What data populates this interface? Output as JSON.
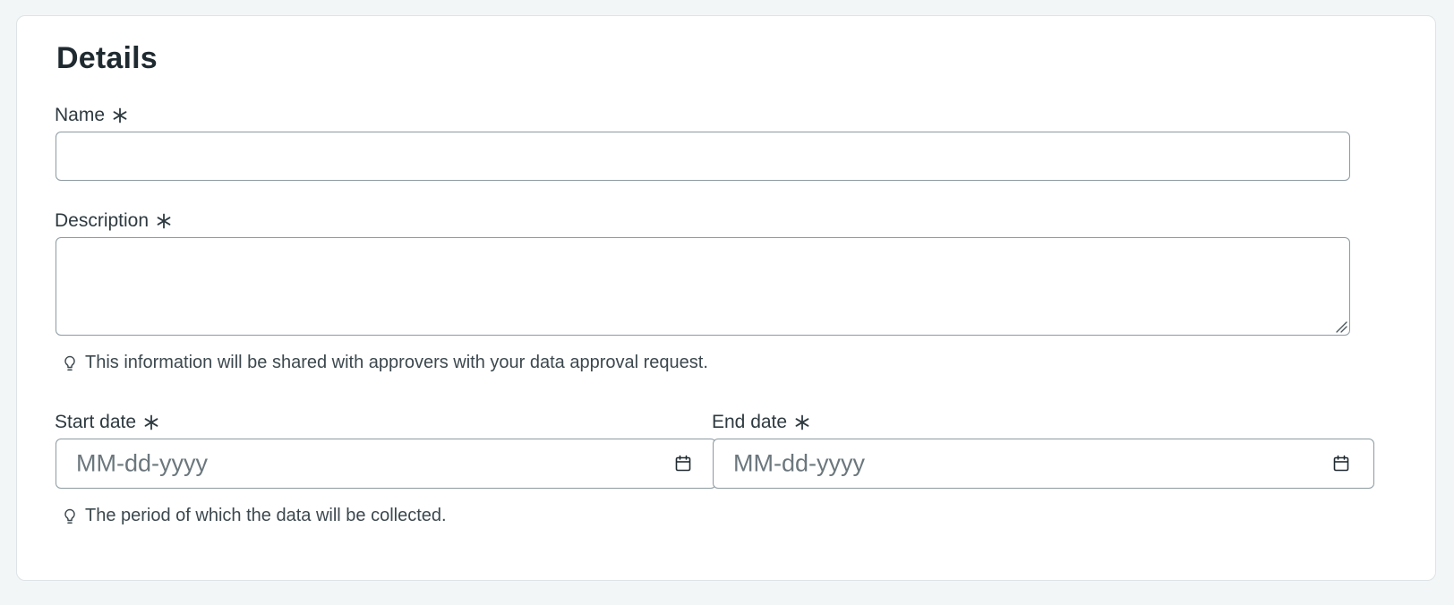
{
  "section": {
    "title": "Details"
  },
  "fields": {
    "name": {
      "label": "Name",
      "value": ""
    },
    "description": {
      "label": "Description",
      "value": "",
      "hint": "This information will be shared with approvers with your data approval request."
    },
    "start_date": {
      "label": "Start date",
      "placeholder": "MM-dd-yyyy"
    },
    "end_date": {
      "label": "End date",
      "placeholder": "MM-dd-yyyy"
    },
    "date_hint": "The period of which the data will be collected."
  },
  "icons": {
    "required": "asterisk-icon",
    "hint": "lightbulb-icon",
    "calendar": "calendar-icon"
  }
}
